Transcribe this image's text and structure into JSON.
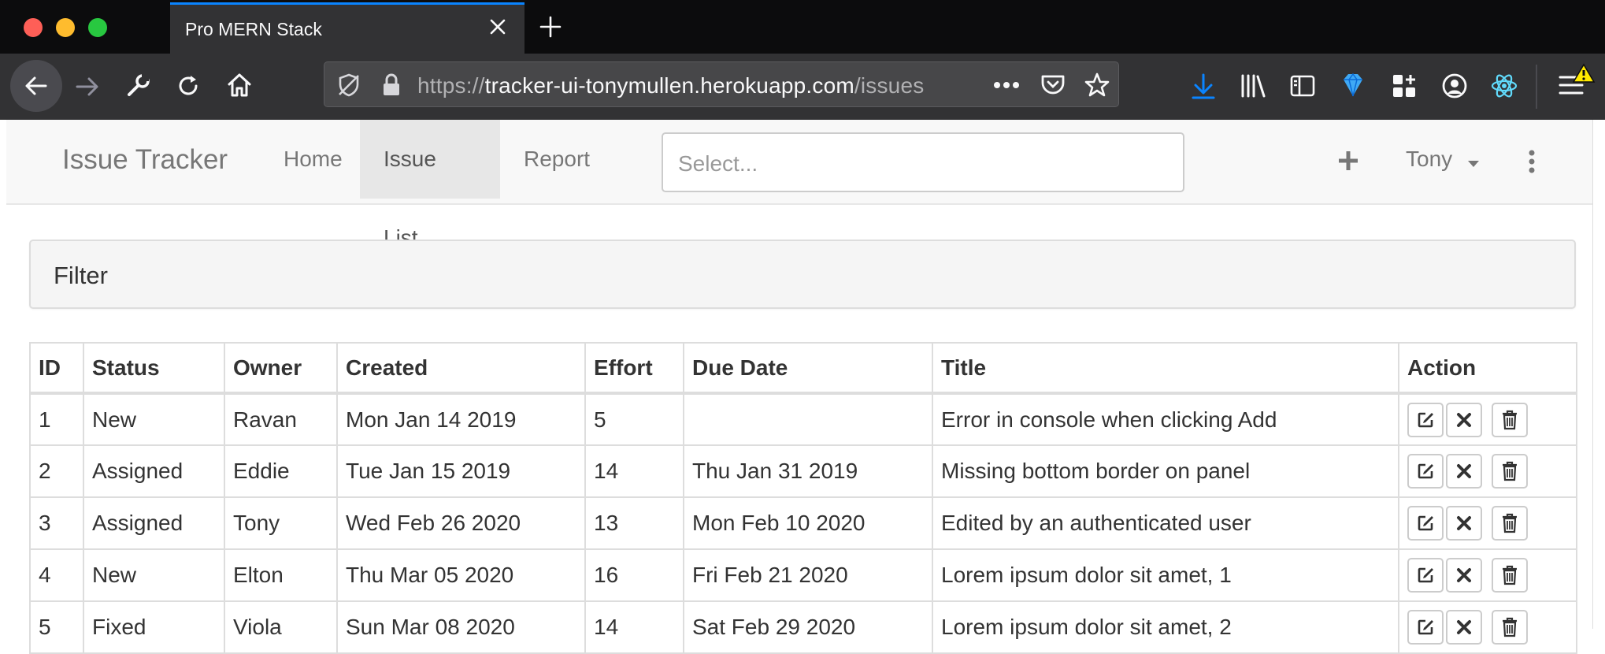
{
  "browser": {
    "tab_title": "Pro MERN Stack",
    "url": {
      "scheme": "https://",
      "domain": "tracker-ui-tonymullen.herokuapp.com",
      "path": "/issues"
    }
  },
  "app": {
    "brand": "Issue Tracker",
    "nav": {
      "home": "Home",
      "issue_list": "Issue List",
      "report": "Report"
    },
    "search_placeholder": "Select...",
    "user_name": "Tony"
  },
  "filter": {
    "title": "Filter"
  },
  "table": {
    "headers": {
      "id": "ID",
      "status": "Status",
      "owner": "Owner",
      "created": "Created",
      "effort": "Effort",
      "due": "Due Date",
      "title": "Title",
      "action": "Action"
    },
    "rows": [
      {
        "id": "1",
        "status": "New",
        "owner": "Ravan",
        "created": "Mon Jan 14 2019",
        "effort": "5",
        "due": "",
        "title": "Error in console when clicking Add"
      },
      {
        "id": "2",
        "status": "Assigned",
        "owner": "Eddie",
        "created": "Tue Jan 15 2019",
        "effort": "14",
        "due": "Thu Jan 31 2019",
        "title": "Missing bottom border on panel"
      },
      {
        "id": "3",
        "status": "Assigned",
        "owner": "Tony",
        "created": "Wed Feb 26 2020",
        "effort": "13",
        "due": "Mon Feb 10 2020",
        "title": "Edited by an authenticated user"
      },
      {
        "id": "4",
        "status": "New",
        "owner": "Elton",
        "created": "Thu Mar 05 2020",
        "effort": "16",
        "due": "Fri Feb 21 2020",
        "title": "Lorem ipsum dolor sit amet, 1"
      },
      {
        "id": "5",
        "status": "Fixed",
        "owner": "Viola",
        "created": "Sun Mar 08 2020",
        "effort": "14",
        "due": "Sat Feb 29 2020",
        "title": "Lorem ipsum dolor sit amet, 2"
      }
    ]
  },
  "colors": {
    "tab_accent": "#0a84ff",
    "window_bg": "#0c0c0d",
    "toolbar_bg": "#323234",
    "download_icon": "#0a84ff"
  }
}
